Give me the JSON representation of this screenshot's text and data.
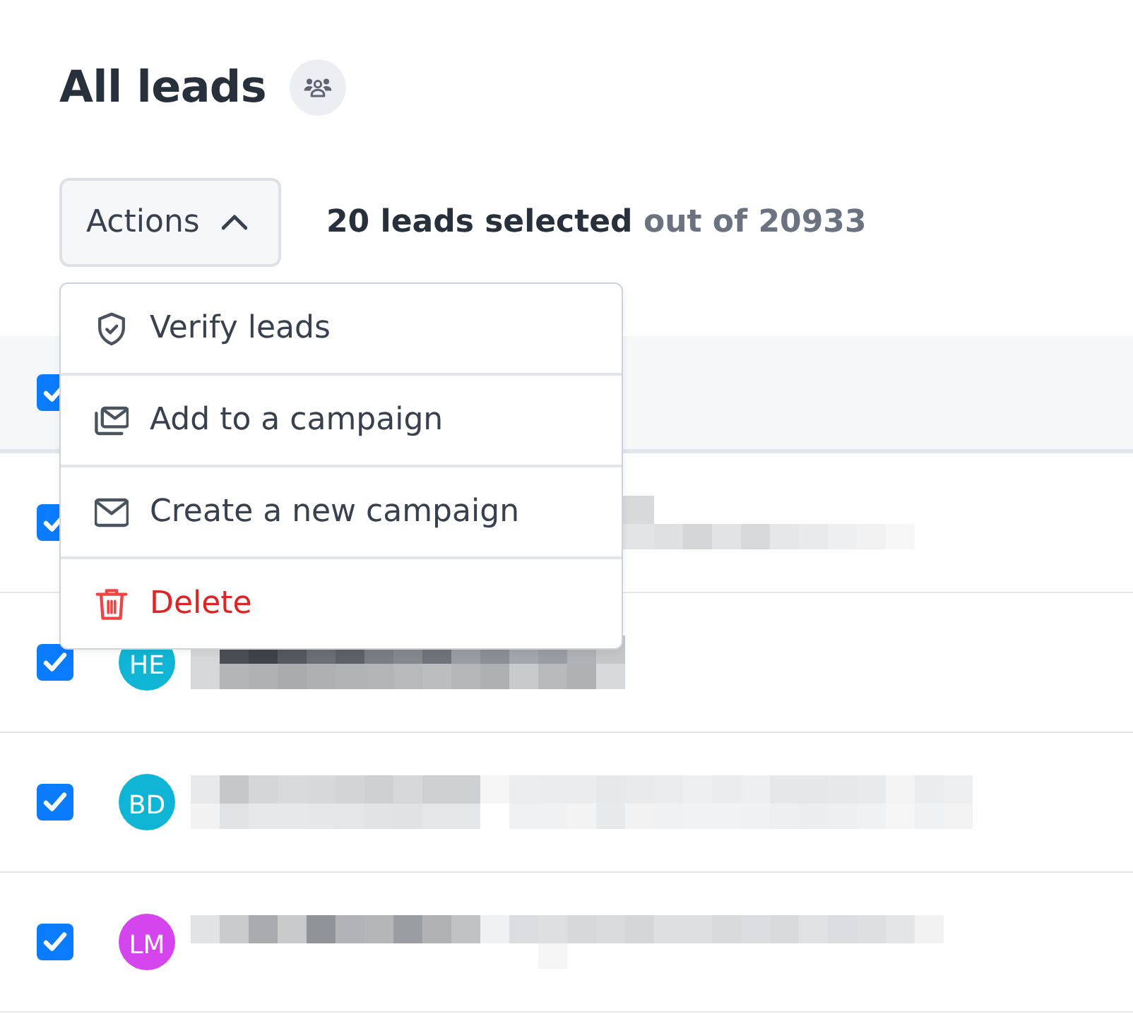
{
  "page": {
    "title": "All leads"
  },
  "toolbar": {
    "actions_button": {
      "label": "Actions",
      "expanded": true
    },
    "selection_summary": "**20 leads selected** out of 20933"
  },
  "actions_menu": {
    "items": [
      {
        "kind": "verify",
        "label": "Verify leads"
      },
      {
        "kind": "add",
        "label": "Add to a campaign"
      },
      {
        "kind": "create",
        "label": "Create a new campaign"
      },
      {
        "kind": "delete",
        "label": "Delete"
      }
    ]
  },
  "table": {
    "header": {
      "select_all": true
    },
    "rows": [
      {
        "selected": true
      },
      {
        "selected": true,
        "initials": "HE",
        "color": "#10b4d4"
      },
      {
        "selected": true,
        "initials": "BD",
        "color": "#10b4d4"
      },
      {
        "selected": true,
        "initials": "LM",
        "color": "#d545ee"
      }
    ]
  }
}
